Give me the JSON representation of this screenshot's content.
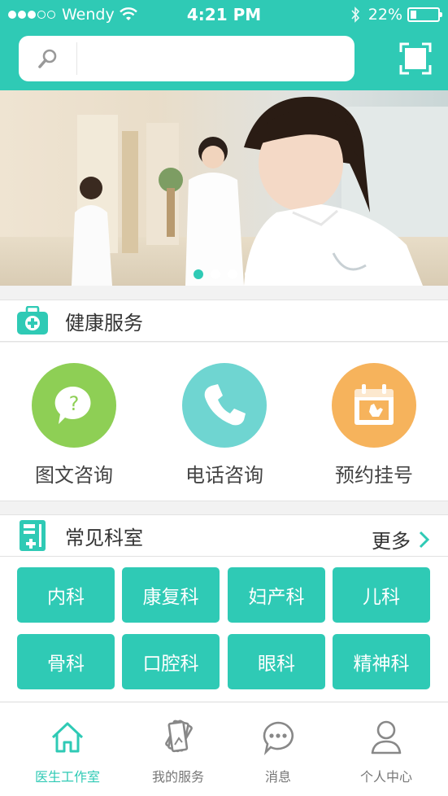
{
  "status_bar": {
    "carrier": "Wendy",
    "time": "4:21 PM",
    "battery": "22%"
  },
  "search": {
    "placeholder": ""
  },
  "banner": {
    "pages": 4,
    "active_page": 1
  },
  "health_services": {
    "title": "健康服务",
    "items": [
      {
        "label": "图文咨询",
        "icon": "chat-question-icon",
        "color": "#8ecf55"
      },
      {
        "label": "电话咨询",
        "icon": "phone-icon",
        "color": "#6fd5d1"
      },
      {
        "label": "预约挂号",
        "icon": "calendar-icon",
        "color": "#f6b35c"
      }
    ]
  },
  "departments": {
    "title": "常见科室",
    "more_label": "更多",
    "items": [
      "内科",
      "康复科",
      "妇产科",
      "儿科",
      "骨科",
      "口腔科",
      "眼科",
      "精神科"
    ]
  },
  "tabbar": {
    "items": [
      {
        "label": "医生工作室",
        "icon": "home-icon",
        "active": true
      },
      {
        "label": "我的服务",
        "icon": "cards-icon",
        "active": false
      },
      {
        "label": "消息",
        "icon": "message-icon",
        "active": false
      },
      {
        "label": "个人中心",
        "icon": "user-icon",
        "active": false
      }
    ]
  },
  "colors": {
    "accent": "#2fcab5",
    "green": "#8ecf55",
    "teal": "#6fd5d1",
    "orange": "#f6b35c"
  }
}
